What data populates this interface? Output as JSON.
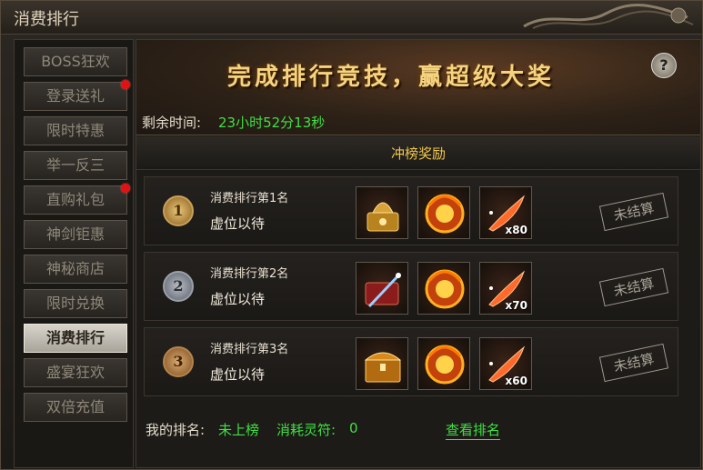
{
  "window": {
    "title": "消费排行"
  },
  "sidebar": {
    "items": [
      {
        "label": "BOSS狂欢",
        "badge": false,
        "active": false
      },
      {
        "label": "登录送礼",
        "badge": true,
        "active": false
      },
      {
        "label": "限时特惠",
        "badge": false,
        "active": false
      },
      {
        "label": "举一反三",
        "badge": false,
        "active": false
      },
      {
        "label": "直购礼包",
        "badge": true,
        "active": false
      },
      {
        "label": "神剑钜惠",
        "badge": false,
        "active": false
      },
      {
        "label": "神秘商店",
        "badge": false,
        "active": false
      },
      {
        "label": "限时兑换",
        "badge": false,
        "active": false
      },
      {
        "label": "消费排行",
        "badge": false,
        "active": true
      },
      {
        "label": "盛宴狂欢",
        "badge": false,
        "active": false
      },
      {
        "label": "双倍充值",
        "badge": false,
        "active": false
      }
    ]
  },
  "banner": {
    "text": "完成排行竞技，赢超级大奖",
    "help": "?"
  },
  "timer": {
    "label": "剩余时间:",
    "value": "23小时52分13秒"
  },
  "section": {
    "title": "冲榜奖励"
  },
  "rewards": [
    {
      "medal": "1",
      "title": "消费排行第1名",
      "holder": "虚位以待",
      "status": "未结算",
      "items": [
        {
          "icon": "golden-helmet-chest-icon",
          "qty": ""
        },
        {
          "icon": "dragon-orb-icon",
          "qty": ""
        },
        {
          "icon": "flame-feather-icon",
          "qty": "x80"
        }
      ]
    },
    {
      "medal": "2",
      "title": "消费排行第2名",
      "holder": "虚位以待",
      "status": "未结算",
      "items": [
        {
          "icon": "sword-chest-icon",
          "qty": ""
        },
        {
          "icon": "dragon-orb-icon",
          "qty": ""
        },
        {
          "icon": "flame-feather-icon",
          "qty": "x70"
        }
      ]
    },
    {
      "medal": "3",
      "title": "消费排行第3名",
      "holder": "虚位以待",
      "status": "未结算",
      "items": [
        {
          "icon": "treasure-chest-icon",
          "qty": ""
        },
        {
          "icon": "dragon-orb-icon",
          "qty": ""
        },
        {
          "icon": "flame-feather-icon",
          "qty": "x60"
        }
      ]
    }
  ],
  "footer": {
    "rank_label": "我的排名:",
    "rank_value": "未上榜",
    "spent_label": "消耗灵符:",
    "spent_value": "0",
    "view_link": "查看排名"
  },
  "colors": {
    "accent_green": "#3fe043",
    "accent_gold": "#f0c64a",
    "badge_red": "#e21212"
  }
}
